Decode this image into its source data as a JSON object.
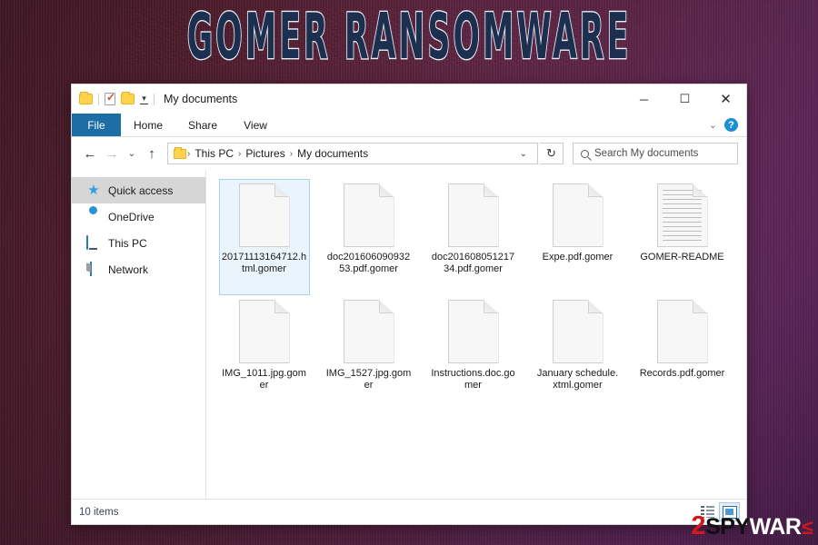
{
  "banner": {
    "title": "GOMER RANSOMWARE"
  },
  "window": {
    "title": "My documents",
    "quick_access": {
      "folder_icon": "folder-icon",
      "properties_icon": "properties-checkbox-icon",
      "new_folder_icon": "new-folder-icon",
      "customize_caret": "▾"
    },
    "controls": {
      "minimize": "─",
      "maximize": "☐",
      "close": "✕"
    },
    "ribbon": {
      "tabs": [
        {
          "label": "File",
          "active": true
        },
        {
          "label": "Home",
          "active": false
        },
        {
          "label": "Share",
          "active": false
        },
        {
          "label": "View",
          "active": false
        }
      ],
      "collapse_caret": "⌄",
      "help_glyph": "?"
    },
    "address": {
      "back": "←",
      "forward": "→",
      "recent": "⌄",
      "up": "↑",
      "breadcrumbs": [
        "This PC",
        "Pictures",
        "My documents"
      ],
      "separator": "›",
      "dropdown_caret": "⌄",
      "refresh_glyph": "↻"
    },
    "search": {
      "placeholder": "Search My documents",
      "icon": "search-icon"
    },
    "sidebar": {
      "items": [
        {
          "label": "Quick access",
          "icon": "star-icon",
          "active": true
        },
        {
          "label": "OneDrive",
          "icon": "cloud-icon",
          "active": false
        },
        {
          "label": "This PC",
          "icon": "monitor-icon",
          "active": false
        },
        {
          "label": "Network",
          "icon": "network-icon",
          "active": false
        }
      ]
    },
    "files": [
      {
        "name": "20171113164712.html.gomer",
        "icon": "blank-document-icon",
        "selected": true
      },
      {
        "name": "doc20160609093253.pdf.gomer",
        "icon": "blank-document-icon",
        "selected": false
      },
      {
        "name": "doc20160805121734.pdf.gomer",
        "icon": "blank-document-icon",
        "selected": false
      },
      {
        "name": "Expe.pdf.gomer",
        "icon": "blank-document-icon",
        "selected": false
      },
      {
        "name": "GOMER-README",
        "icon": "text-document-icon",
        "selected": false
      },
      {
        "name": "IMG_1011.jpg.gomer",
        "icon": "blank-document-icon",
        "selected": false
      },
      {
        "name": "IMG_1527.jpg.gomer",
        "icon": "blank-document-icon",
        "selected": false
      },
      {
        "name": "Instructions.doc.gomer",
        "icon": "blank-document-icon",
        "selected": false
      },
      {
        "name": "January schedule.xtml.gomer",
        "icon": "blank-document-icon",
        "selected": false
      },
      {
        "name": "Records.pdf.gomer",
        "icon": "blank-document-icon",
        "selected": false
      }
    ],
    "statusbar": {
      "item_count": "10 items",
      "view_details_icon": "details-view-icon",
      "view_large_icons_icon": "large-icons-view-icon"
    }
  },
  "watermark": {
    "part_2": "2",
    "part_spy": "SPY",
    "part_war": "WAR",
    "part_arrow": "≤"
  },
  "colors": {
    "file_tab_blue": "#1c6ea4",
    "selection_fill": "#eaf4fd",
    "selection_border": "#a8d3f0",
    "sidebar_active": "#d6d6d6",
    "help_blue": "#1b8fd6",
    "folder_yellow": "#ffd34e",
    "banner_fill": "#1d2f4f",
    "banner_stroke": "#e8eef5",
    "watermark_red": "#d01a1a",
    "desktop_maroon": "#4a1a2a",
    "desktop_purple": "#6b2b68"
  }
}
